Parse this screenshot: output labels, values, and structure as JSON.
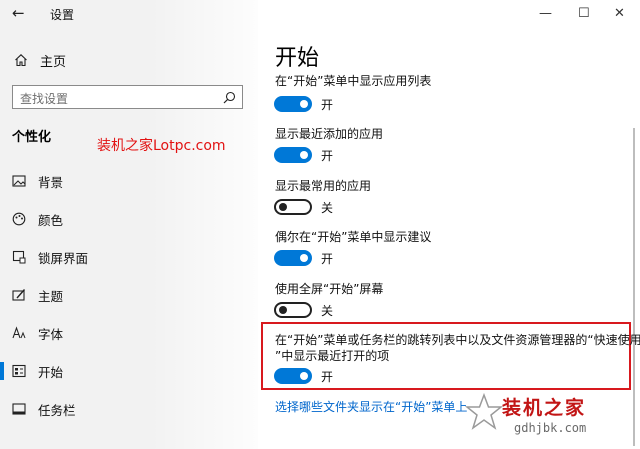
{
  "window": {
    "title": "设置",
    "back_glyph": "←",
    "minimize_glyph": "—",
    "maximize_glyph": "☐",
    "close_glyph": "✕"
  },
  "nav": {
    "home_label": "主页",
    "search_placeholder": "查找设置",
    "section_title": "个性化",
    "items": [
      {
        "label": "背景",
        "icon": "picture-icon"
      },
      {
        "label": "颜色",
        "icon": "palette-icon"
      },
      {
        "label": "锁屏界面",
        "icon": "lock-screen-icon"
      },
      {
        "label": "主题",
        "icon": "theme-brush-icon"
      },
      {
        "label": "字体",
        "icon": "font-icon"
      },
      {
        "label": "开始",
        "icon": "start-menu-icon",
        "active": true
      },
      {
        "label": "任务栏",
        "icon": "taskbar-icon"
      }
    ]
  },
  "overlay": {
    "red_caption": "装机之家Lotpc.com",
    "logo_text": "装机之家",
    "logo_url": "gdhjbk.com"
  },
  "content": {
    "page_title": "开始",
    "settings": [
      {
        "label": "在“开始”菜单中显示应用列表",
        "state": "开",
        "on": true
      },
      {
        "label": "显示最近添加的应用",
        "state": "开",
        "on": true
      },
      {
        "label": "显示最常用的应用",
        "state": "关",
        "on": false
      },
      {
        "label": "偶尔在“开始”菜单中显示建议",
        "state": "开",
        "on": true
      },
      {
        "label": "使用全屏“开始”屏幕",
        "state": "关",
        "on": false
      },
      {
        "label_line1": "在“开始”菜单或任务栏的跳转列表中以及文件资源管理器的“快速使用",
        "label_line2": "”中显示最近打开的项",
        "state": "开",
        "on": true
      }
    ],
    "link_text": "选择哪些文件夹显示在“开始”菜单上"
  },
  "colors": {
    "accent": "#0078d7",
    "highlight_border": "#d8191e",
    "link": "#0066cc",
    "watermark_red": "#e21212"
  }
}
